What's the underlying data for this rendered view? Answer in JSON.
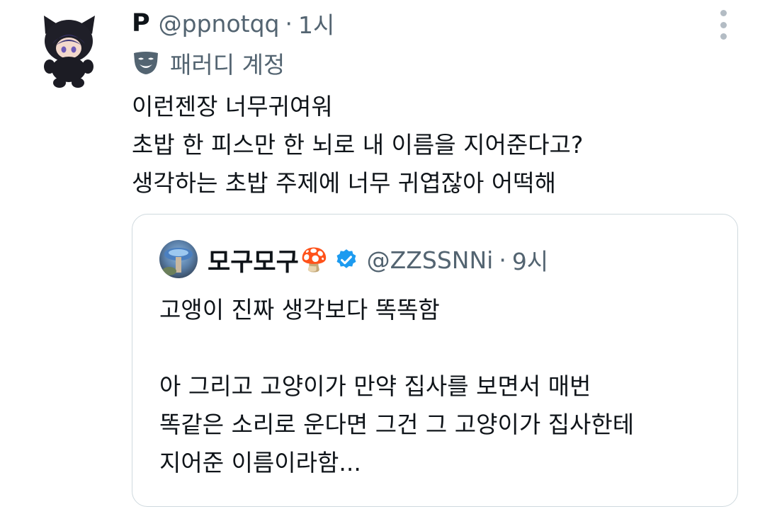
{
  "tweet": {
    "display_name": "P",
    "handle": "@ppnotqq",
    "separator": "·",
    "time": "1시",
    "label_icon": "parody-mask-icon",
    "label": "패러디 계정",
    "lines": [
      "이런젠장 너무귀여워",
      "초밥 한 피스만 한 뇌로 내 이름을 지어준다고?",
      "생각하는 초밥 주제에 너무 귀엽잖아 어떡해"
    ],
    "menu_icon": "more-vertical-icon"
  },
  "quoted": {
    "display_name": "모구모구",
    "emoji": "🍄",
    "verified_icon": "verified-badge-icon",
    "handle": "@ZZSSNNi",
    "separator": "·",
    "time": "9시",
    "lines": [
      "고앵이 진짜 생각보다 똑똑함",
      "",
      "아 그리고 고양이가 만약 집사를 보면서 매번",
      "똑같은 소리로 운다면 그건 그 고양이가 집사한테",
      "지어준 이름이라함..."
    ]
  },
  "colors": {
    "text": "#0f1419",
    "secondary": "#536471",
    "border": "#cfd9de",
    "verified": "#1d9bf0"
  }
}
